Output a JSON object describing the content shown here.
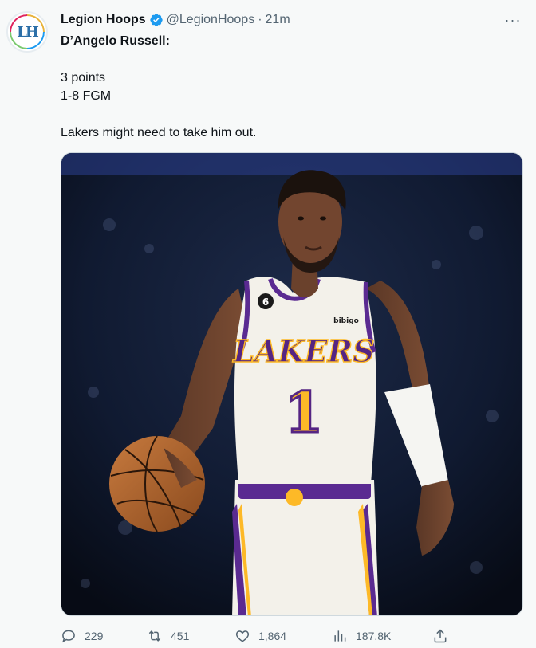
{
  "tweet": {
    "author_name": "Legion Hoops",
    "handle": "@LegionHoops",
    "separator": "·",
    "time": "21m",
    "avatar_text": "LH",
    "more_label": "···",
    "lines": {
      "title": "D’Angelo Russell:",
      "line1": "3 points",
      "line2": "1-8 FGM",
      "line3": "Lakers might need to take him out."
    },
    "media": {
      "jersey_brand": "LAKERS",
      "jersey_number": "1",
      "patch_number": "6",
      "sponsor": "bibigo"
    },
    "stats": {
      "replies": "229",
      "retweets": "451",
      "likes": "1,864",
      "views": "187.8K"
    }
  },
  "colors": {
    "verified": "#1d9bf0",
    "jersey_purple": "#552583",
    "jersey_gold": "#fdb927"
  },
  "icons": [
    "verified-badge-icon",
    "more-icon",
    "reply-icon",
    "retweet-icon",
    "like-icon",
    "views-icon",
    "share-icon"
  ]
}
